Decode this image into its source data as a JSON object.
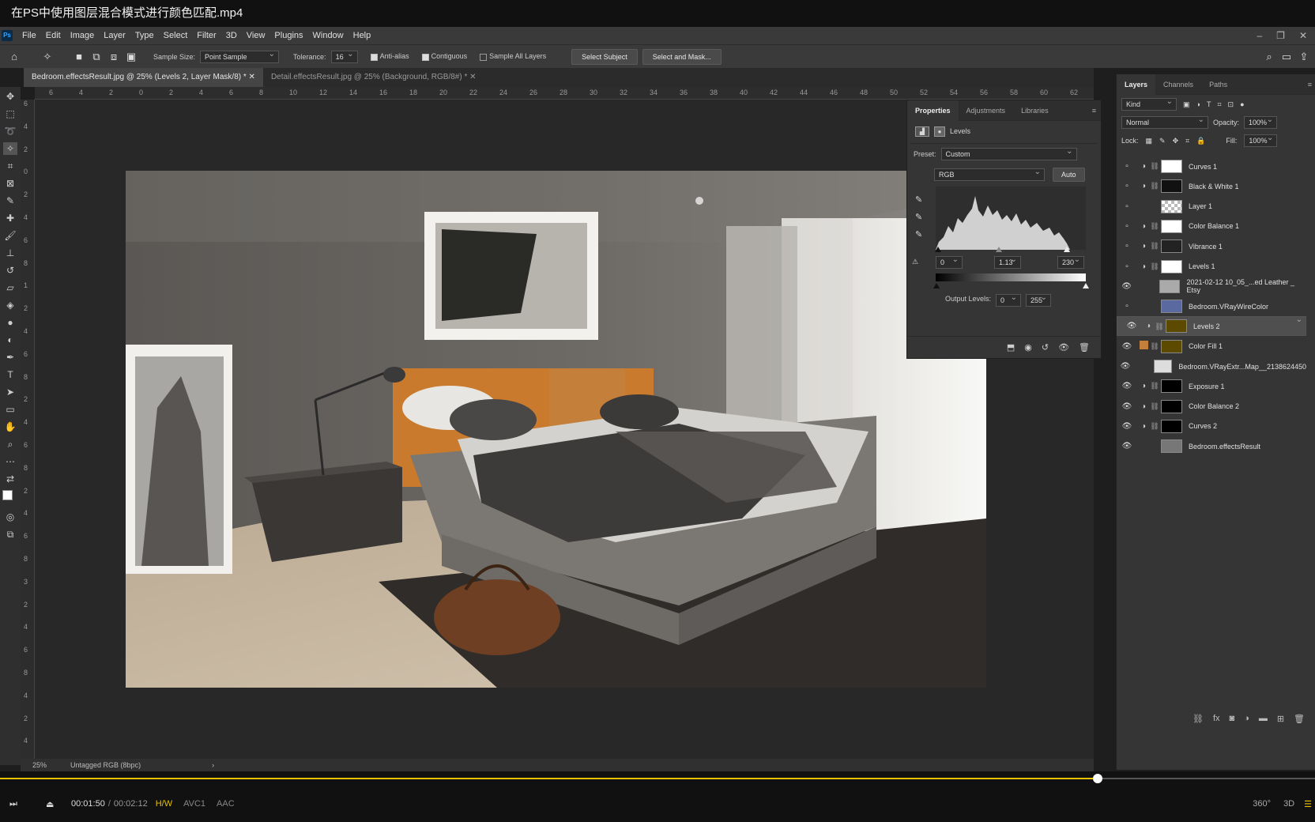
{
  "video_title": "在PS中使用图层混合模式进行颜色匹配.mp4",
  "menu": [
    "File",
    "Edit",
    "Image",
    "Layer",
    "Type",
    "Select",
    "Filter",
    "3D",
    "View",
    "Plugins",
    "Window",
    "Help"
  ],
  "options": {
    "sample_size_label": "Sample Size:",
    "sample_size_value": "Point Sample",
    "tolerance_label": "Tolerance:",
    "tolerance_value": "16",
    "anti_alias": "Anti-alias",
    "contiguous": "Contiguous",
    "sample_all": "Sample All Layers",
    "select_subject": "Select Subject",
    "select_mask": "Select and Mask..."
  },
  "tabs": [
    {
      "label": "Bedroom.effectsResult.jpg @ 25% (Levels 2, Layer Mask/8) *"
    },
    {
      "label": "Detail.effectsResult.jpg @ 25% (Background, RGB/8#) *"
    }
  ],
  "ruler_h": [
    "6",
    "4",
    "2",
    "0",
    "2",
    "4",
    "6",
    "8",
    "10",
    "12",
    "14",
    "16",
    "18",
    "20",
    "22",
    "24",
    "26",
    "28",
    "30",
    "32",
    "34",
    "36",
    "38",
    "40",
    "42",
    "44",
    "46",
    "48",
    "50",
    "52",
    "54",
    "56",
    "58",
    "60",
    "62"
  ],
  "ruler_v": [
    "6",
    "4",
    "2",
    "0",
    "2",
    "4",
    "6",
    "8",
    "1",
    "2",
    "4",
    "6",
    "8",
    "2",
    "4",
    "6",
    "8",
    "2",
    "4",
    "6",
    "8",
    "3",
    "2",
    "4",
    "6",
    "8",
    "4",
    "2",
    "4"
  ],
  "status": {
    "zoom": "25%",
    "color_profile": "Untagged RGB (8bpc)"
  },
  "properties": {
    "tabs": [
      "Properties",
      "Adjustments",
      "Libraries"
    ],
    "title": "Levels",
    "preset_label": "Preset:",
    "preset_value": "Custom",
    "channel": "RGB",
    "auto": "Auto",
    "input_black": "0",
    "input_gamma": "1.13",
    "input_white": "230",
    "output_label": "Output Levels:",
    "output_black": "0",
    "output_white": "255"
  },
  "layers_panel": {
    "tabs": [
      "Layers",
      "Channels",
      "Paths"
    ],
    "filter": "Kind",
    "blend_mode": "Normal",
    "opacity_label": "Opacity:",
    "opacity": "100%",
    "lock_label": "Lock:",
    "fill_label": "Fill:",
    "fill": "100%",
    "layers": [
      {
        "name": "Curves 1",
        "visible": false
      },
      {
        "name": "Black & White 1",
        "visible": false
      },
      {
        "name": "Layer 1",
        "visible": false
      },
      {
        "name": "Color Balance 1",
        "visible": false
      },
      {
        "name": "Vibrance 1",
        "visible": false
      },
      {
        "name": "Levels 1",
        "visible": false
      },
      {
        "name": "2021-02-12 10_05_...ed Leather _ Etsy",
        "visible": true
      },
      {
        "name": "Bedroom.VRayWireColor",
        "visible": false
      },
      {
        "name": "Levels 2",
        "visible": true
      },
      {
        "name": "Color Fill 1",
        "visible": true
      },
      {
        "name": "Bedroom.VRayExtr...Map__2138624450",
        "visible": true
      },
      {
        "name": "Exposure 1",
        "visible": true
      },
      {
        "name": "Color Balance 2",
        "visible": true
      },
      {
        "name": "Curves 2",
        "visible": true
      },
      {
        "name": "Bedroom.effectsResult",
        "visible": true
      }
    ]
  },
  "player": {
    "current": "00:01:50",
    "separator": "/",
    "total": "00:02:12",
    "hw": "H/W",
    "video_codec": "AVC1",
    "audio_codec": "AAC",
    "progress": 0.835,
    "three_d": "3D",
    "deg360": "360°"
  },
  "colors": {
    "accent": "#e8c100",
    "swatch": "#c4803b",
    "photo_headboard": "#c97a2c"
  }
}
